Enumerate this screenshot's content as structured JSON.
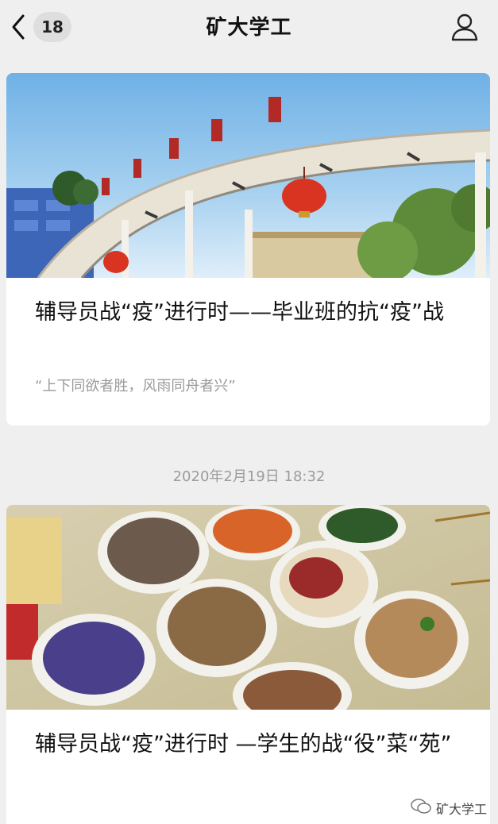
{
  "header": {
    "title": "矿大学工",
    "unread_count": "18",
    "back_icon": "chevron-left-icon",
    "profile_icon": "person-icon"
  },
  "articles": [
    {
      "title": "辅导员战“疫”进行时——毕业班的抗“疫”战",
      "subtitle": "“上下同欲者胜，风雨同舟者兴”"
    },
    {
      "title": "辅导员战“疫”进行时 —学生的战“役”菜“苑”"
    }
  ],
  "timestamp": "2020年2月19日 18:32",
  "watermark": {
    "icon": "wechat-icon",
    "label": "矿大学工"
  },
  "colors": {
    "background": "#efefef",
    "card": "#ffffff",
    "meta_text": "#9c9c9c"
  }
}
